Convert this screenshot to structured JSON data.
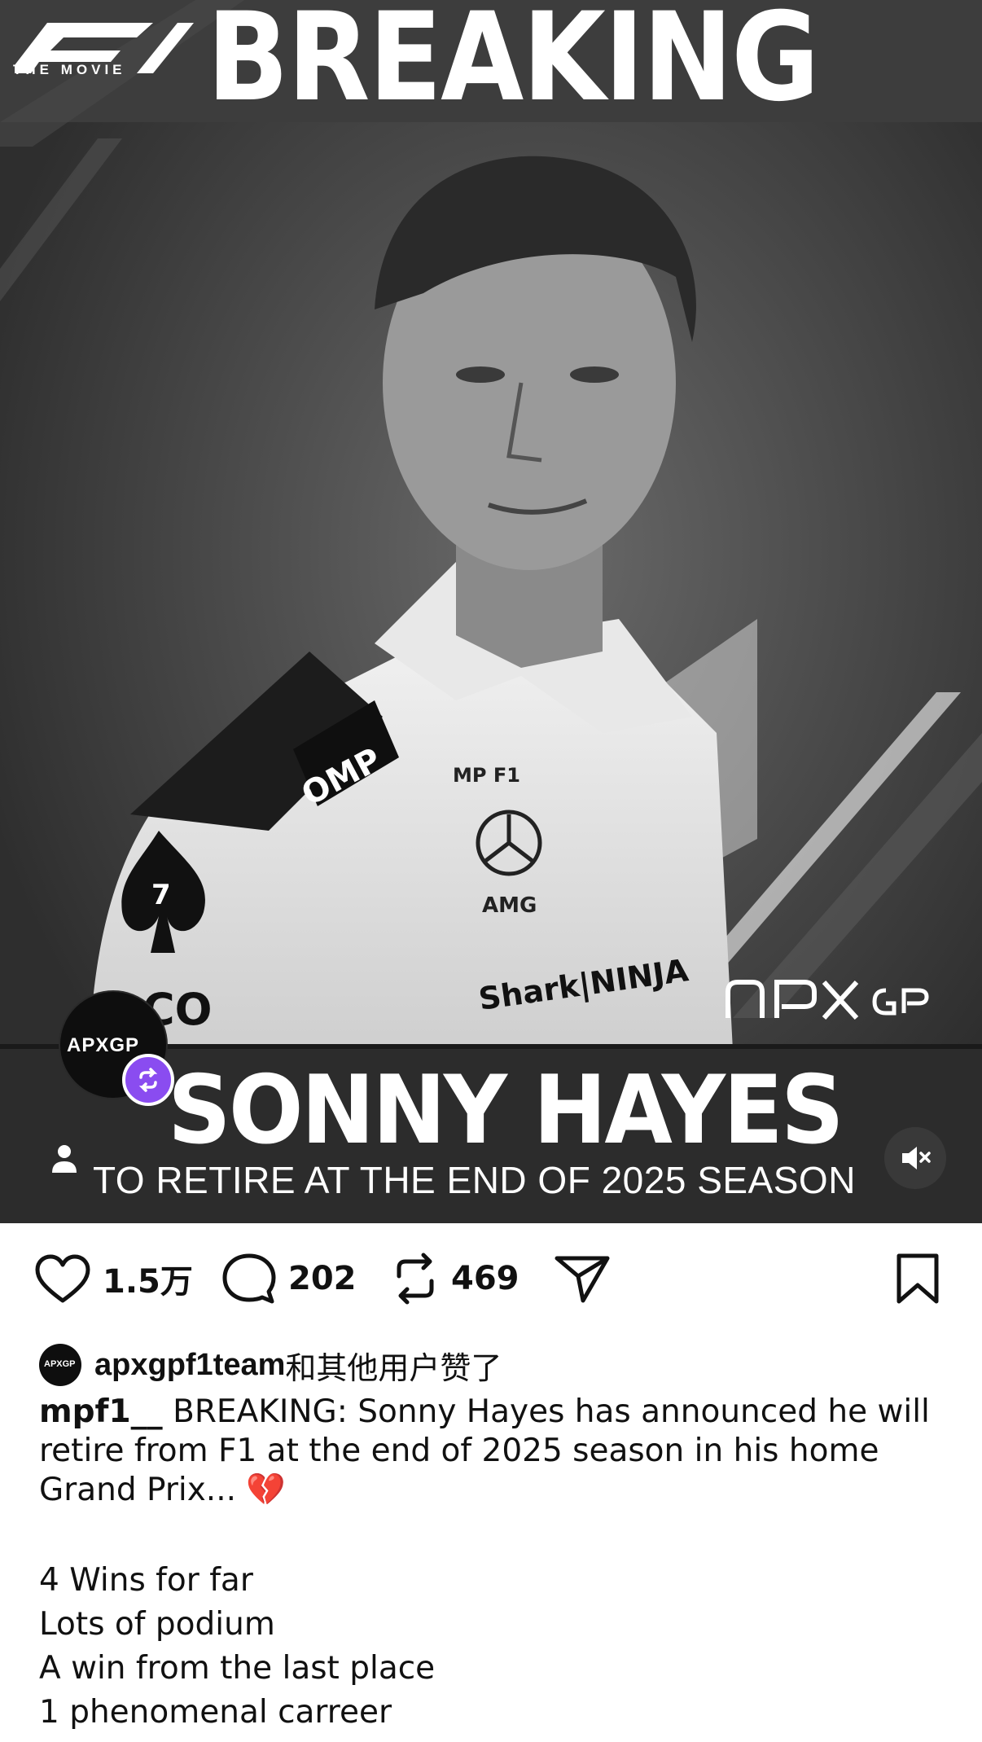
{
  "post_image": {
    "brand": "THE MOVIE",
    "headline": "BREAKING",
    "name": "SONNY HAYES",
    "subline": "TO RETIRE AT THE END OF 2025 SEASON",
    "team_logo": "APXGP",
    "avatar_text": "APXGP"
  },
  "actions": {
    "likes": "1.5万",
    "comments": "202",
    "reposts": "469",
    "icons": [
      "heart-icon",
      "comment-icon",
      "repost-icon",
      "share-icon",
      "bookmark-icon"
    ]
  },
  "likers": {
    "name": "apxgpf1team",
    "rest": "和其他用户赞了"
  },
  "caption": {
    "author": "mpf1__",
    "text": "BREAKING: Sonny Hayes has announced he will retire from F1 at the end of 2025 season in his home Grand Prix... 💔",
    "lines": [
      "4 Wins for far",
      "Lots of podium",
      "A win from the last place",
      "1 phenomenal carreer"
    ]
  },
  "colors": {
    "repost_badge": "#8a4cf0",
    "image_bg": "#3a3a3a"
  }
}
